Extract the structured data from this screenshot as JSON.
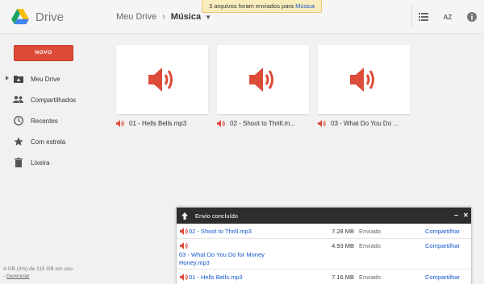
{
  "app": {
    "title": "Drive"
  },
  "breadcrumb": {
    "root": "Meu Drive",
    "separator": "›",
    "current": "Música"
  },
  "notification": {
    "text": "3 arquivos foram enviados para",
    "link": "Música"
  },
  "toolbar": {
    "list_icon": "list-icon",
    "sort_icon": "sort-az-icon",
    "sort_label": "AZ",
    "info_icon": "info-icon"
  },
  "sidebar": {
    "new_button": "NOVO",
    "items": [
      {
        "label": "Meu Drive",
        "icon": "drive-folder-icon"
      },
      {
        "label": "Compartilhados",
        "icon": "people-icon"
      },
      {
        "label": "Recentes",
        "icon": "clock-icon"
      },
      {
        "label": "Com estrela",
        "icon": "star-icon"
      },
      {
        "label": "Lixeira",
        "icon": "trash-icon"
      }
    ],
    "storage": "4 GB (3%) de 115 GB em uso",
    "manage": "Gerenciar",
    "manage_prefix": "- "
  },
  "files": [
    {
      "name": "01 - Hells Bells.mp3"
    },
    {
      "name": "02 - Shoot to Thrill.m..."
    },
    {
      "name": "03 - What Do You Do ..."
    }
  ],
  "upload_panel": {
    "title": "Envio concluído",
    "minimize": "–",
    "close": "✕",
    "rows": [
      {
        "name": "02 - Shoot to Thrill.mp3",
        "size": "7.28 MB",
        "status": "Enviado",
        "action": "Compartilhar"
      },
      {
        "name_line1": "03 - What Do You Do for Money",
        "name_line2": "Honey.mp3",
        "size": "4.93 MB",
        "status": "Enviado",
        "action": "Compartilhar"
      },
      {
        "name": "01 - Hells Bells.mp3",
        "size": "7.16 MB",
        "status": "Enviado",
        "action": "Compartilhar"
      }
    ]
  },
  "colors": {
    "accent": "#dd4b39",
    "link": "#1155cc",
    "header": "#2d2d2d",
    "notify_bg": "#f9edbe"
  }
}
